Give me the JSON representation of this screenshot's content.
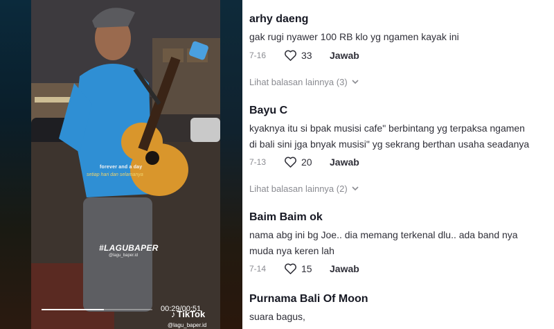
{
  "video": {
    "lyric_en": "forever and a day",
    "lyric_id": "setiap hari dan selamanya",
    "hashtag": "#LAGUBAPER",
    "hashtag_handle": "@lagu_baper.id",
    "time": "00:29/00:51",
    "logo_text": "TikTok",
    "handle": "@lagu_baper.id",
    "progress": 0.56
  },
  "comments": [
    {
      "user": "arhy daeng",
      "lines": [
        "gak rugi nyawer 100 RB klo yg ngamen kayak ini"
      ],
      "date": "7-16",
      "likes": "33",
      "reply_label": "Jawab"
    },
    {
      "user": "Bayu C",
      "lines": [
        "kyaknya itu si bpak musisi cafe\" berbintang yg terpaksa ngamen",
        "di bali sini jga bnyak musisi\" yg sekrang berthan usaha seadanya"
      ],
      "date": "7-13",
      "likes": "20",
      "reply_label": "Jawab"
    },
    {
      "user": "Baim Baim ok",
      "lines": [
        "nama abg ini bg Joe.. dia memang terkenal dlu.. ada band nya",
        "muda nya keren lah"
      ],
      "date": "7-14",
      "likes": "15",
      "reply_label": "Jawab"
    },
    {
      "user": "Purnama Bali Of Moon",
      "lines": [
        "suara bagus,"
      ],
      "date": "",
      "likes": "",
      "reply_label": ""
    }
  ],
  "view_replies": [
    "Lihat balasan lainnya (3)",
    "Lihat balasan lainnya (2)"
  ],
  "colors": {
    "text_dark": "#161823",
    "text_gray": "#8a8b91",
    "lyric_yellow": "#f1d36a"
  }
}
